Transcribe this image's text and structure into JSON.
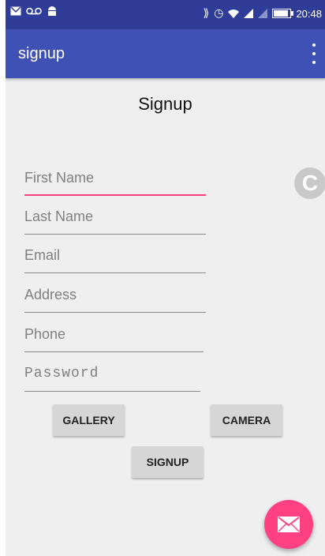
{
  "status_bar": {
    "left_icons": [
      "mail-icon",
      "voicemail-icon",
      "android-icon"
    ],
    "right_icons": [
      "vibrate-icon",
      "alarm-icon",
      "wifi-icon",
      "signal-icon",
      "signal-icon",
      "battery-icon"
    ],
    "time": "20:48"
  },
  "toolbar": {
    "title": "signup",
    "menu_icon": "more-vert-icon",
    "color": "#3f51b5"
  },
  "form": {
    "heading": "Signup",
    "fields": [
      {
        "placeholder": "First Name",
        "value": ""
      },
      {
        "placeholder": "Last Name",
        "value": ""
      },
      {
        "placeholder": "Email",
        "value": ""
      },
      {
        "placeholder": "Address",
        "value": ""
      },
      {
        "placeholder": "Phone",
        "value": ""
      },
      {
        "placeholder": "Password",
        "value": ""
      }
    ],
    "buttons": {
      "gallery": "GALLERY",
      "camera": "CAMERA",
      "signup": "SIGNUP"
    }
  },
  "side_icon": {
    "letter": "C"
  },
  "fab": {
    "icon": "mail-icon",
    "color": "#ff4081"
  }
}
